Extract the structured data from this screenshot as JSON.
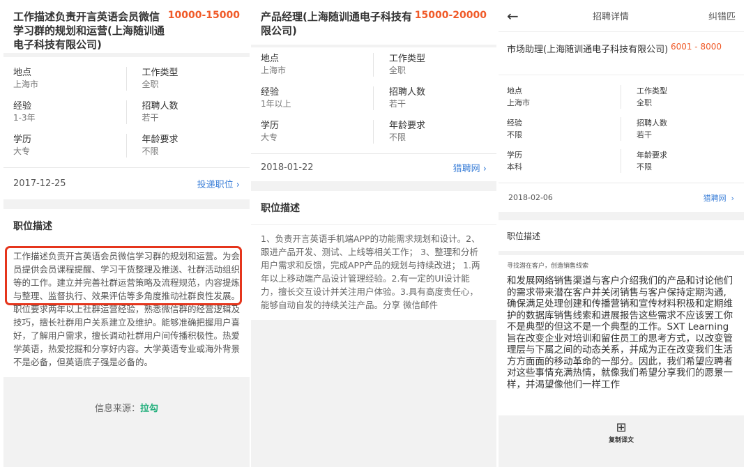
{
  "panel1": {
    "title": "工作描述负责开言英语会员微信学习群的规划和运营(上海随训通电子科技有限公司)",
    "salary": "10000-15000",
    "details": [
      {
        "label": "地点",
        "value": "上海市"
      },
      {
        "label": "工作类型",
        "value": "全职"
      },
      {
        "label": "经验",
        "value": "1-3年"
      },
      {
        "label": "招聘人数",
        "value": "若干"
      },
      {
        "label": "学历",
        "value": "大专"
      },
      {
        "label": "年龄要求",
        "value": "不限"
      }
    ],
    "date": "2017-12-25",
    "action": "投递职位",
    "section_title": "职位描述",
    "description": "工作描述负责开言英语会员微信学习群的规划和运营。为会员提供会员课程提醒、学习干货整理及推送、社群活动组织等的工作。建立并完善社群运营策略及流程规范，内容提炼与整理、监督执行、效果评估等多角度推动社群良性发展。职位要求两年以上社群运营经验，熟悉微信群的经营逻辑及技巧，擅长社群用户关系建立及维护。能够准确把握用户喜好，了解用户需求，擅长调动社群用户间传播积极性。热爱学英语，热爱挖掘和分享好内容。大学英语专业或海外背景不是必备，但英语底子强是必备的。",
    "source_label": "信息来源：",
    "source_logo": "拉勾"
  },
  "panel2": {
    "title": "产品经理(上海随训通电子科技有限公司)",
    "salary": "15000-20000",
    "details": [
      {
        "label": "地点",
        "value": "上海市"
      },
      {
        "label": "工作类型",
        "value": "全职"
      },
      {
        "label": "经验",
        "value": "1年以上"
      },
      {
        "label": "招聘人数",
        "value": "若干"
      },
      {
        "label": "学历",
        "value": "大专"
      },
      {
        "label": "年龄要求",
        "value": "不限"
      }
    ],
    "date": "2018-01-22",
    "action": "猎聘网",
    "section_title": "职位描述",
    "description": "1、负责开言英语手机端APP的功能需求规划和设计。2、跟进产品开发、测试、上线等相关工作； 3、整理和分析用户需求和反馈，完成APP产品的规划与持续改进； 1.两年以上移动端产品设计管理经验。2.有一定的UI设计能力，擅长交互设计并关注用户体验。3.具有高度责任心，能够自动自发的持续关注产品。分享 微信邮件"
  },
  "panel3": {
    "header_title": "招聘详情",
    "header_right": "纠错匹",
    "title": "市场助理(上海随训通电子科技有限公司)",
    "salary": "6001 - 8000",
    "details": [
      {
        "label": "地点",
        "value": "上海市"
      },
      {
        "label": "工作类型",
        "value": "全职"
      },
      {
        "label": "经验",
        "value": "不限"
      },
      {
        "label": "招聘人数",
        "value": "若干"
      },
      {
        "label": "学历",
        "value": "本科"
      },
      {
        "label": "年龄要求",
        "value": "不限"
      }
    ],
    "date": "2018-02-06",
    "action": "猎聘网",
    "section_title": "职位描述",
    "subtitle": "寻找潜在客户，创造销售线索",
    "description": "和发展网络销售渠道与客户介绍我们的产品和讨论他们的需求带来潜在客户并关闭销售与客户保持定期沟通,确保满足处理创建和传播营销和宣传材料积极和定期维护的数据库销售线索和进展报告这些需求不应该罢工你不是典型的但这不是一个典型的工作。SXT Learning旨在改变企业对培训和留住员工的思考方式，以改变管理层与下属之间的动态关系，并成为正在改变我们生活方方面面的移动革命的一部分。因此，我们希望应聘者对这些事情充满热情，就像我们希望分享我们的愿景一样，并渴望像他们一样工作",
    "copy_label": "复制译文"
  },
  "colors": {
    "salary": "#f05a28",
    "link": "#3b7fd8",
    "highlight": "#e5351c",
    "logo": "#1fae7a"
  }
}
